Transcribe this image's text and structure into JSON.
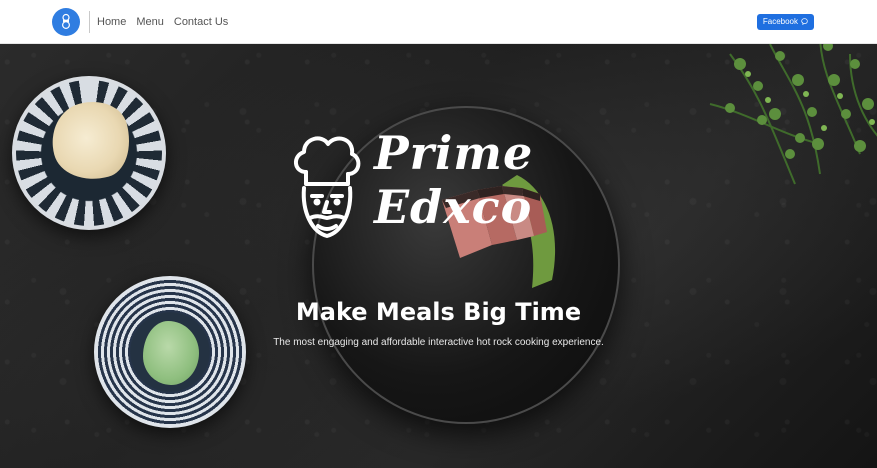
{
  "nav": {
    "links": [
      "Home",
      "Menu",
      "Contact Us"
    ],
    "facebook_label": "Facebook"
  },
  "hero": {
    "logo_line1": "Prime",
    "logo_line2": "Edxco",
    "headline": "Make Meals Big Time",
    "tagline": "The most engaging and affordable interactive hot rock cooking experience."
  },
  "colors": {
    "brand_blue": "#2f7de1",
    "facebook_button": "#1f6fe0",
    "navbar_bg": "#ffffff"
  }
}
